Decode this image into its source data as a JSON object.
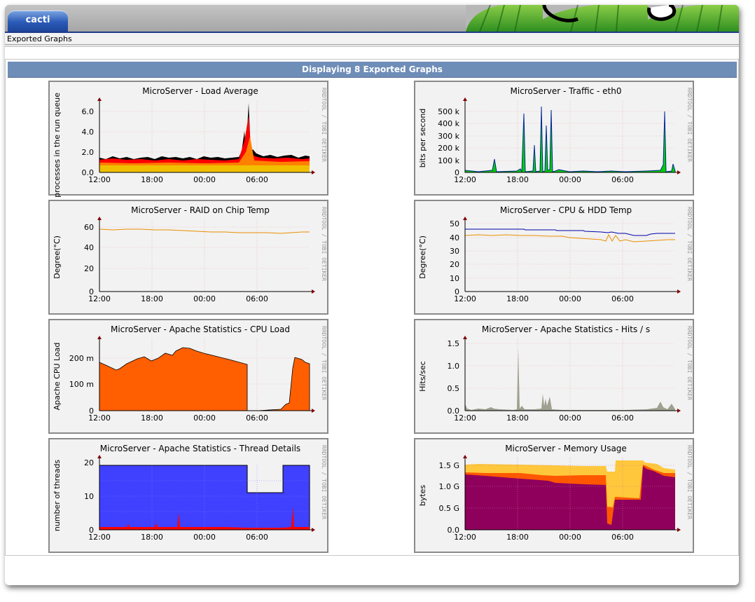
{
  "app": {
    "tab_label": "cacti",
    "breadcrumb": "Exported Graphs"
  },
  "main": {
    "header": "Displaying 8 Exported Graphs"
  },
  "watermark": "RRDTOOL / TOBI OETIKER",
  "graphs": [
    {
      "title": "MicroServer - Load Average",
      "ylabel": "processes in the run queue",
      "yticks": [
        "0.0",
        "2.0",
        "4.0",
        "6.0"
      ],
      "xticks": [
        "12:00",
        "18:00",
        "00:00",
        "06:00"
      ],
      "colors": [
        "#f0c000",
        "#ff8000",
        "#ff0000",
        "#000000"
      ]
    },
    {
      "title": "MicroServer - Traffic - eth0",
      "ylabel": "bits per second",
      "yticks": [
        "0",
        "100 k",
        "200 k",
        "300 k",
        "400 k",
        "500 k"
      ],
      "xticks": [
        "12:00",
        "18:00",
        "00:00",
        "06:00"
      ],
      "colors": [
        "#00cf00",
        "#002a97"
      ]
    },
    {
      "title": "MicroServer - RAID on Chip Temp",
      "ylabel": "Degree(°C)",
      "yticks": [
        "0",
        "20",
        "40",
        "60"
      ],
      "xticks": [
        "12:00",
        "18:00",
        "00:00",
        "06:00"
      ],
      "colors": [
        "#ea8f00"
      ]
    },
    {
      "title": "MicroServer - CPU & HDD Temp",
      "ylabel": "Degree(°C)",
      "yticks": [
        "0",
        "10",
        "20",
        "30",
        "40",
        "50"
      ],
      "xticks": [
        "12:00",
        "18:00",
        "00:00",
        "06:00"
      ],
      "colors": [
        "#0000aa",
        "#ea8f00"
      ]
    },
    {
      "title": "MicroServer - Apache Statistics - CPU Load",
      "ylabel": "Apache CPU Load",
      "yticks": [
        "0",
        "100 m",
        "200 m"
      ],
      "xticks": [
        "12:00",
        "18:00",
        "00:00",
        "06:00"
      ],
      "colors": [
        "#ff5f00",
        "#000000"
      ]
    },
    {
      "title": "MicroServer - Apache Statistics - Hits / s",
      "ylabel": "Hits/sec",
      "yticks": [
        "0.0",
        "0.5",
        "1.0",
        "1.5"
      ],
      "xticks": [
        "12:00",
        "18:00",
        "00:00",
        "06:00"
      ],
      "colors": [
        "#a0a090"
      ]
    },
    {
      "title": "MicroServer - Apache Statistics - Thread Details",
      "ylabel": "number of threads",
      "yticks": [
        "0",
        "10",
        "20"
      ],
      "xticks": [
        "12:00",
        "18:00",
        "00:00",
        "06:00"
      ],
      "colors": [
        "#4040ff",
        "#ff0000",
        "#000000"
      ]
    },
    {
      "title": "MicroServer - Memory Usage",
      "ylabel": "bytes",
      "yticks": [
        "0.0",
        "0.5 G",
        "1.0 G",
        "1.5 G"
      ],
      "xticks": [
        "12:00",
        "18:00",
        "00:00",
        "06:00"
      ],
      "colors": [
        "#8f005c",
        "#ff5700",
        "#ffc73b"
      ]
    }
  ]
}
